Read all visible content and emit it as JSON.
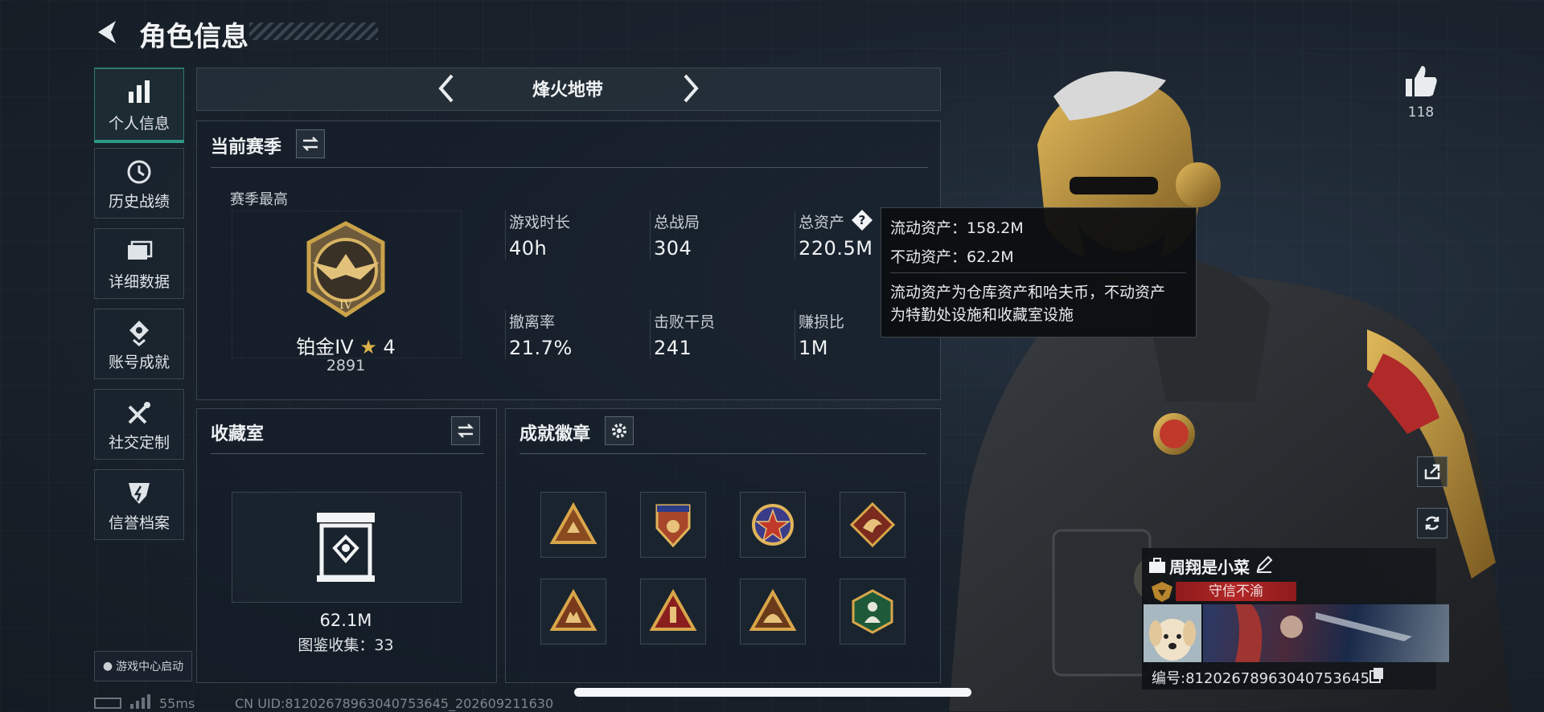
{
  "header": {
    "title": "角色信息"
  },
  "nav": {
    "items": [
      {
        "label": "个人信息",
        "icon": "bar-chart-icon",
        "active": true
      },
      {
        "label": "历史战绩",
        "icon": "clock-icon"
      },
      {
        "label": "详细数据",
        "icon": "folder-icon"
      },
      {
        "label": "账号成就",
        "icon": "medal-icon"
      },
      {
        "label": "社交定制",
        "icon": "tools-icon"
      },
      {
        "label": "信誉档案",
        "icon": "shield-icon"
      }
    ],
    "game_center_label": "游戏中心启动"
  },
  "mode_selector": {
    "label": "烽火地带"
  },
  "season": {
    "title": "当前赛季",
    "highest_label": "赛季最高",
    "rank_name": "铂金IV",
    "rank_stars": "4",
    "rank_score": "2891",
    "stats": [
      {
        "label": "游戏时长",
        "value": "40h"
      },
      {
        "label": "总战局",
        "value": "304"
      },
      {
        "label": "总资产",
        "value": "220.5M"
      },
      {
        "label": "撤离率",
        "value": "21.7%"
      },
      {
        "label": "击败干员",
        "value": "241"
      },
      {
        "label": "赚损比",
        "value": "1M"
      }
    ]
  },
  "tooltip": {
    "line1": "流动资产：158.2M",
    "line2": "不动资产：62.2M",
    "line3": "流动资产为仓库资产和哈夫币，不动资产",
    "line4": "为特勤处设施和收藏室设施"
  },
  "collection": {
    "title": "收藏室",
    "value": "62.1M",
    "catalog": "图鉴收集：33"
  },
  "badges": {
    "title": "成就徽章",
    "items": [
      "badge-1",
      "badge-2",
      "badge-3",
      "badge-4",
      "badge-5",
      "badge-6",
      "badge-7",
      "badge-8"
    ]
  },
  "profile": {
    "likes": "118",
    "player_name": "周翔是小菜",
    "reputation": "守信不渝",
    "id_number": "编号:81202678963040753645"
  },
  "status_bar": {
    "ping": "55ms",
    "uid": "CN UID:81202678963040753645_202609211630"
  },
  "colors": {
    "accent": "#2e7a6a",
    "gold": "#c9a24a",
    "reputation_red": "#8e1c1c"
  }
}
